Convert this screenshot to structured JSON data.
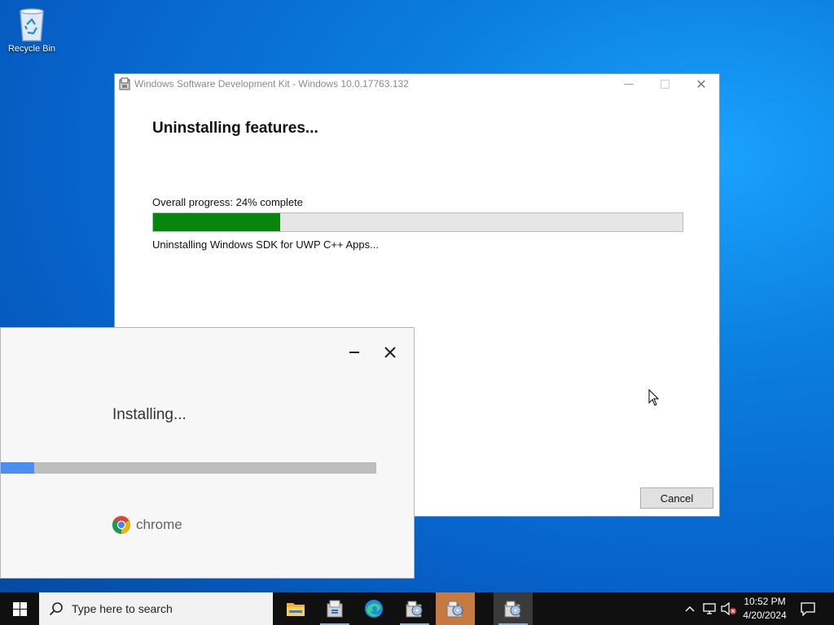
{
  "desktop": {
    "recycle_bin_label": "Recycle Bin"
  },
  "sdk_window": {
    "title": "Windows Software Development Kit - Windows 10.0.17763.132",
    "heading": "Uninstalling features...",
    "progress_label": "Overall progress: 24% complete",
    "progress_fraction": 0.24,
    "status": "Uninstalling Windows SDK for UWP C++ Apps...",
    "cancel_label": "Cancel"
  },
  "chrome_installer": {
    "status": "Installing...",
    "progress_fraction": 0.09,
    "wordmark": "chrome"
  },
  "taskbar": {
    "search_placeholder": "Type here to search",
    "apps": [
      "file-explorer-icon",
      "sdk-setup-icon",
      "edge-icon",
      "installer-icon",
      "installer-icon",
      "installer-icon"
    ],
    "clock_time": "10:52 PM",
    "clock_date": "4/20/2024"
  },
  "colors": {
    "sdk_progress": "#06860c",
    "chrome_progress": "#4a8ef0",
    "taskbar": "#101010",
    "desktop": "#0662c9"
  }
}
